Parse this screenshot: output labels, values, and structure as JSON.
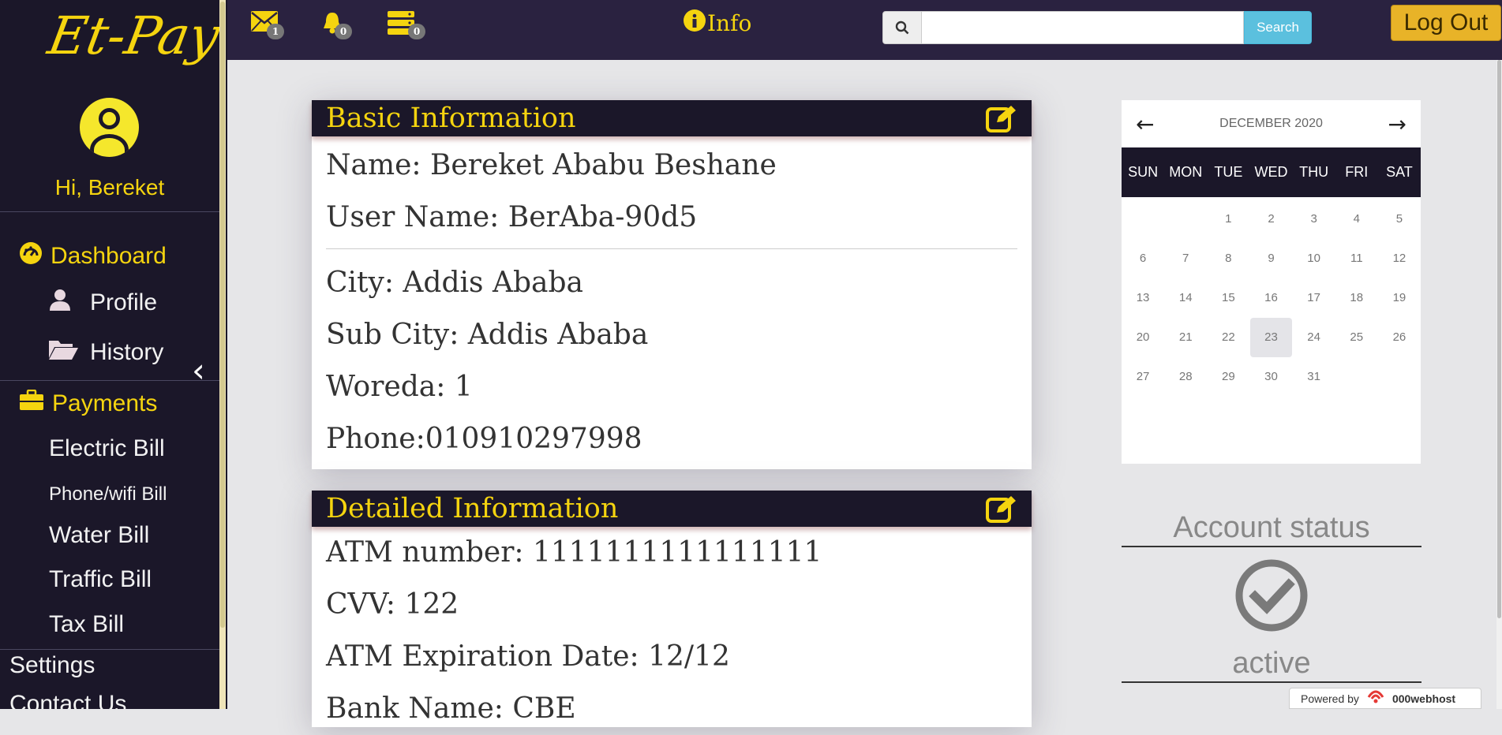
{
  "sidebar": {
    "logo": "Et-Pay",
    "greeting": "Hi, Bereket",
    "nav": {
      "dashboard": "Dashboard",
      "profile": "Profile",
      "history": "History",
      "payments": "Payments",
      "electric": "Electric Bill",
      "phone": "Phone/wifi Bill",
      "water": "Water Bill",
      "traffic": "Traffic Bill",
      "tax": "Tax Bill",
      "settings": "Settings",
      "contact": "Contact Us"
    }
  },
  "topbar": {
    "messages_count": "1",
    "notifications_count": "0",
    "tasks_count": "0",
    "info_label": "Info",
    "search_placeholder": "",
    "search_button": "Search",
    "logout": "Log Out"
  },
  "basic": {
    "title": "Basic Information",
    "name": "Name: Bereket Ababu Beshane",
    "username": "User Name: BerAba-90d5",
    "city": "City: Addis Ababa",
    "subcity": "Sub City: Addis Ababa",
    "woreda": "Woreda: 1",
    "phone": "Phone:010910297998"
  },
  "detailed": {
    "title": "Detailed Information",
    "atm": "ATM number: 1111111111111111",
    "cvv": "CVV: 122",
    "expiry": "ATM Expiration Date: 12/12",
    "bank": "Bank Name: CBE"
  },
  "calendar": {
    "month": "DECEMBER 2020",
    "weekdays": [
      "SUN",
      "MON",
      "TUE",
      "WED",
      "THU",
      "FRI",
      "SAT"
    ],
    "leading_blanks": 2,
    "days_in_month": 31,
    "selected_day": 23
  },
  "account": {
    "title": "Account status",
    "state": "active"
  },
  "footer": {
    "powered_by": "Powered by",
    "host": "000webhost"
  },
  "colors": {
    "sidebar_bg": "#1b1729",
    "accent": "#f5d40f",
    "topbar_bg": "#2a2240",
    "search_btn": "#5bc0de",
    "logout_btn": "#e8b328"
  }
}
